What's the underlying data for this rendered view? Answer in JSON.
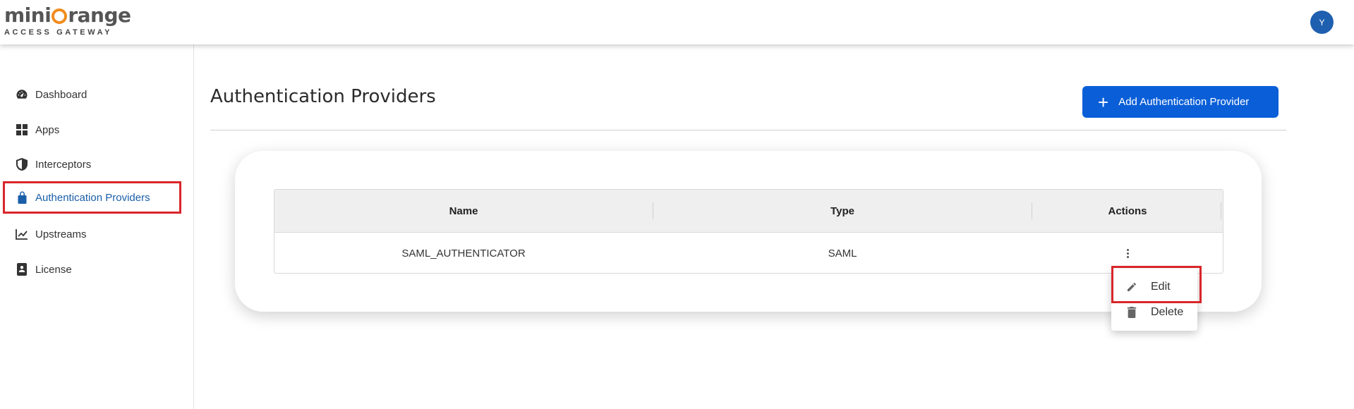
{
  "header": {
    "logo_text_left": "mini",
    "logo_text_right": "range",
    "logo_subtitle": "ACCESS GATEWAY",
    "avatar_initial": "Y"
  },
  "sidebar": {
    "items": [
      {
        "label": "Dashboard",
        "icon": "dashboard-icon",
        "active": false
      },
      {
        "label": "Apps",
        "icon": "apps-grid-icon",
        "active": false
      },
      {
        "label": "Interceptors",
        "icon": "shield-icon",
        "active": false
      },
      {
        "label": "Authentication Providers",
        "icon": "lock-icon",
        "active": true
      },
      {
        "label": "Upstreams",
        "icon": "trending-chart-icon",
        "active": false
      },
      {
        "label": "License",
        "icon": "license-badge-icon",
        "active": false
      }
    ]
  },
  "main": {
    "title": "Authentication Providers",
    "add_button_label": "Add Authentication Provider",
    "table": {
      "columns": [
        "Name",
        "Type",
        "Actions"
      ],
      "rows": [
        {
          "name": "SAML_AUTHENTICATOR",
          "type": "SAML"
        }
      ]
    },
    "actions_menu": {
      "items": [
        {
          "label": "Edit",
          "icon": "pencil-icon"
        },
        {
          "label": "Delete",
          "icon": "trash-icon"
        }
      ]
    }
  },
  "colors": {
    "accent": "#0a5fd8",
    "active_nav": "#1a5fa8",
    "highlight_border": "#d9262a",
    "logo_orange": "#f08c1e",
    "avatar_bg": "#1f5fb0"
  }
}
